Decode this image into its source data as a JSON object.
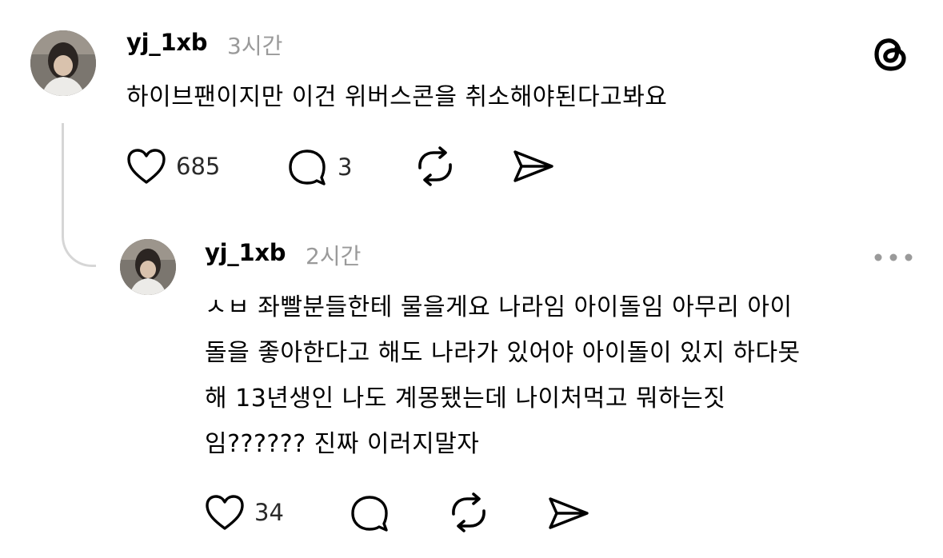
{
  "post": {
    "username": "yj_1xb",
    "time": "3시간",
    "text": "하이브팬이지만 이건 위버스콘을 취소해야된다고봐요",
    "actions": {
      "likes": "685",
      "replies": "3"
    }
  },
  "reply": {
    "username": "yj_1xb",
    "time": "2시간",
    "lines": [
      "ㅅㅂ 좌빨분들한테 물을게요 나라임 아이돌임 아무리 아이",
      "돌을 좋아한다고 해도 나라가 있어야 아이돌이 있지 하다못",
      "해 13년생인 나도 계몽됐는데 나이처먹고 뭐하는짓",
      "임?????? 진짜 이러지말자"
    ],
    "actions": {
      "likes": "34"
    }
  },
  "icons": {
    "app_logo": "threads-logo",
    "like": "heart-icon",
    "reply": "comment-icon",
    "repost": "repost-icon",
    "share": "share-icon",
    "more": "more-options-icon"
  }
}
